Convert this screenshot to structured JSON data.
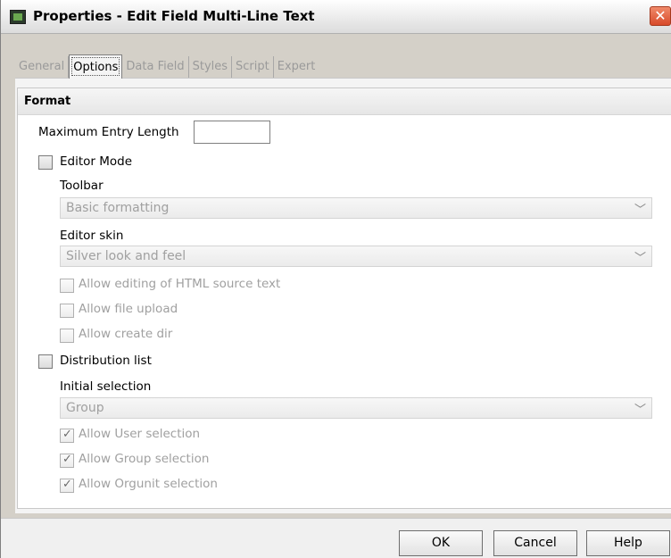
{
  "window": {
    "title": "Properties - Edit Field Multi-Line Text",
    "close_symbol": "✕"
  },
  "tabs": [
    {
      "label": "General",
      "active": false
    },
    {
      "label": "Options",
      "active": true
    },
    {
      "label": "Data Field",
      "active": false
    },
    {
      "label": "Styles",
      "active": false
    },
    {
      "label": "Script",
      "active": false
    },
    {
      "label": "Expert",
      "active": false
    }
  ],
  "format": {
    "section_title": "Format",
    "max_entry_length_label": "Maximum Entry Length",
    "max_entry_length_value": "",
    "editor_mode": {
      "label": "Editor Mode",
      "checked": false
    },
    "toolbar": {
      "label": "Toolbar",
      "value": "Basic formatting"
    },
    "editor_skin": {
      "label": "Editor skin",
      "value": "Silver look and feel"
    },
    "allow_html": {
      "label": "Allow editing of HTML source text",
      "checked": false
    },
    "allow_upload": {
      "label": "Allow file upload",
      "checked": false
    },
    "allow_create_dir": {
      "label": "Allow create dir",
      "checked": false
    },
    "distribution_list": {
      "label": "Distribution list",
      "checked": false
    },
    "initial_selection": {
      "label": "Initial selection",
      "value": "Group"
    },
    "allow_user_selection": {
      "label": "Allow User selection",
      "checked": true
    },
    "allow_group_selection": {
      "label": "Allow Group selection",
      "checked": true
    },
    "allow_orgunit_selection": {
      "label": "Allow Orgunit selection",
      "checked": true
    }
  },
  "buttons": {
    "ok": "OK",
    "cancel": "Cancel",
    "help": "Help"
  },
  "icons": {
    "app": "app-icon",
    "close": "close-icon",
    "dropdown": "chevron-down-icon",
    "check": "checkmark-icon"
  },
  "colors": {
    "close_button": "#d84a2a",
    "disabled_text": "#a0a0a0",
    "panel_bg": "#ffffff"
  }
}
